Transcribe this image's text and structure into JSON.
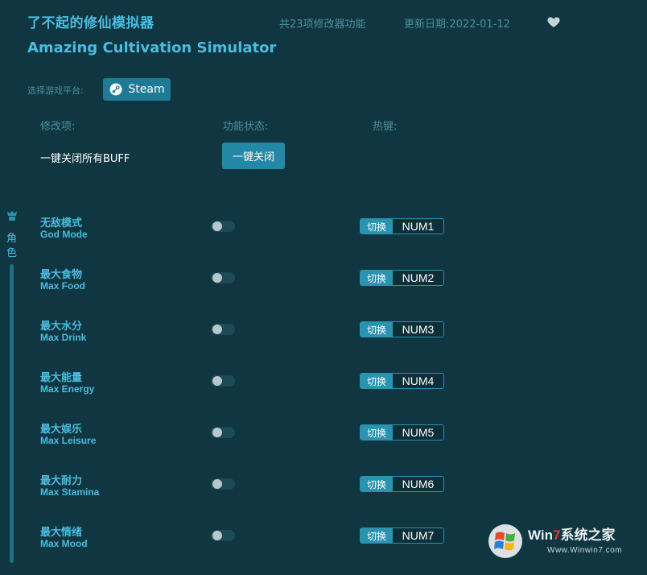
{
  "header": {
    "title_cn": "了不起的修仙模拟器",
    "title_en": "Amazing Cultivation Simulator",
    "feature_count": "共23项修改器功能",
    "update_date": "更新日期:2022-01-12"
  },
  "platform": {
    "label": "选择游戏平台:",
    "steam_label": "Steam"
  },
  "columns": {
    "item": "修改项:",
    "status": "功能状态:",
    "hotkey": "热键:"
  },
  "buff": {
    "label": "一键关闭所有BUFF",
    "button": "一键关闭"
  },
  "sidebar": {
    "category": "角色"
  },
  "items": [
    {
      "cn": "无敌模式",
      "en": "God Mode",
      "action": "切换",
      "key": "NUM1"
    },
    {
      "cn": "最大食物",
      "en": "Max Food",
      "action": "切换",
      "key": "NUM2"
    },
    {
      "cn": "最大水分",
      "en": "Max Drink",
      "action": "切换",
      "key": "NUM3"
    },
    {
      "cn": "最大能量",
      "en": "Max Energy",
      "action": "切换",
      "key": "NUM4"
    },
    {
      "cn": "最大娱乐",
      "en": "Max Leisure",
      "action": "切换",
      "key": "NUM5"
    },
    {
      "cn": "最大耐力",
      "en": "Max Stamina",
      "action": "切换",
      "key": "NUM6"
    },
    {
      "cn": "最大情绪",
      "en": "Max Mood",
      "action": "切换",
      "key": "NUM7"
    }
  ],
  "watermark": {
    "brand_a": "Win",
    "brand_b": "7",
    "brand_c": "系统之家",
    "url": "Www.Winwin7.com"
  },
  "colors": {
    "background": "#0f3641",
    "accent": "#4bbce0",
    "button": "#2388a6"
  },
  "icons": [
    "heart-icon",
    "steam-icon",
    "character-icon",
    "windows-logo-icon"
  ]
}
